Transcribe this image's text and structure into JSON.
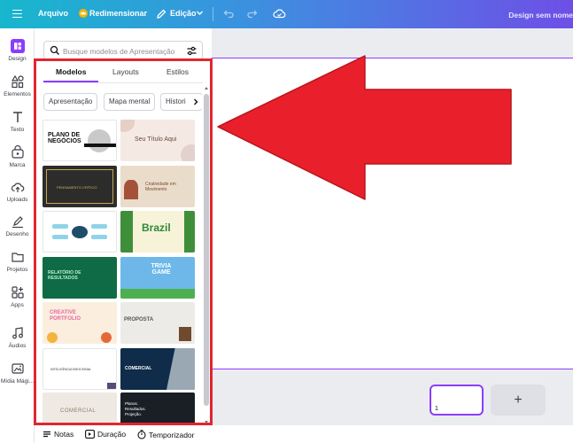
{
  "topbar": {
    "file_label": "Arquivo",
    "resize_label": "Redimensionar",
    "edit_label": "Edição",
    "design_title": "Design sem nome"
  },
  "sidebar": {
    "items": [
      {
        "label": "Design",
        "icon": "design-icon"
      },
      {
        "label": "Elementos",
        "icon": "elements-icon"
      },
      {
        "label": "Texto",
        "icon": "text-icon"
      },
      {
        "label": "Marca",
        "icon": "brand-icon"
      },
      {
        "label": "Uploads",
        "icon": "upload-cloud-icon"
      },
      {
        "label": "Desenho",
        "icon": "draw-icon"
      },
      {
        "label": "Projetos",
        "icon": "folder-icon"
      },
      {
        "label": "Apps",
        "icon": "apps-icon"
      },
      {
        "label": "Áudios",
        "icon": "music-icon"
      },
      {
        "label": "Mídia Mági...",
        "icon": "magic-media-icon"
      }
    ]
  },
  "panel": {
    "search_placeholder": "Busque modelos de Apresentação",
    "tabs": [
      "Modelos",
      "Layouts",
      "Estilos"
    ],
    "chips": [
      "Apresentação",
      "Mapa mental",
      "Histori"
    ],
    "templates": [
      {
        "text": "PLANO DE NEGÓCIOS"
      },
      {
        "text": "Seu Título Aqui"
      },
      {
        "text": "PENSAMENTO CRÍTICO"
      },
      {
        "text": "Criatividade em Movimento"
      },
      {
        "text": ""
      },
      {
        "text": "Brazil"
      },
      {
        "text": "RELATÓRIO DE RESULTADOS"
      },
      {
        "text": "TRIVIA GAME"
      },
      {
        "text": "CREATIVE PORTFOLIO"
      },
      {
        "text": "PROPOSTA"
      },
      {
        "text": "INTELIGÊNCIA EMOCIONAL"
      },
      {
        "text": "COMERCIAL"
      },
      {
        "text": "COMERCIAL"
      },
      {
        "text": "Planos. Resultados. Projeção."
      }
    ]
  },
  "bottombar": {
    "notes_label": "Notas",
    "duration_label": "Duração",
    "timer_label": "Temporizador"
  },
  "pages": {
    "current_page": "1",
    "add_label": "+"
  },
  "colors": {
    "accent": "#8b3dff",
    "annotation": "#e12630"
  }
}
